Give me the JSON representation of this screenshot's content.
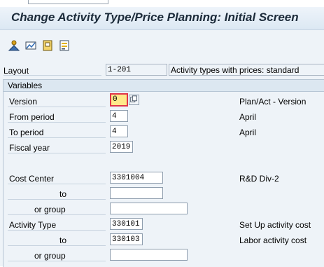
{
  "window": {
    "title": "Change Activity Type/Price Planning: Initial Screen"
  },
  "toolbar": {
    "icons": [
      "overview-icon",
      "planner-profile-icon",
      "save-icon",
      "list-icon"
    ]
  },
  "layout": {
    "label": "Layout",
    "value": "1-201",
    "description": "Activity types with prices: standard"
  },
  "variables": {
    "header": "Variables",
    "version": {
      "label": "Version",
      "value": "0",
      "description": "Plan/Act - Version"
    },
    "from_period": {
      "label": "From period",
      "value": "4",
      "description": "April"
    },
    "to_period": {
      "label": "To period",
      "value": "4",
      "description": "April"
    },
    "fiscal_year": {
      "label": "Fiscal year",
      "value": "2019"
    },
    "cost_center": {
      "label": "Cost Center",
      "value": "3301004",
      "description": "R&D Div-2"
    },
    "cost_center_to": {
      "label": "to",
      "value": ""
    },
    "cost_center_group": {
      "label": "or group",
      "value": ""
    },
    "activity_type": {
      "label": "Activity Type",
      "value": "330101",
      "description": "Set Up activity cost"
    },
    "activity_type_to": {
      "label": "to",
      "value": "330103",
      "description": "Labor activity cost"
    },
    "activity_type_group": {
      "label": "or group",
      "value": ""
    }
  }
}
